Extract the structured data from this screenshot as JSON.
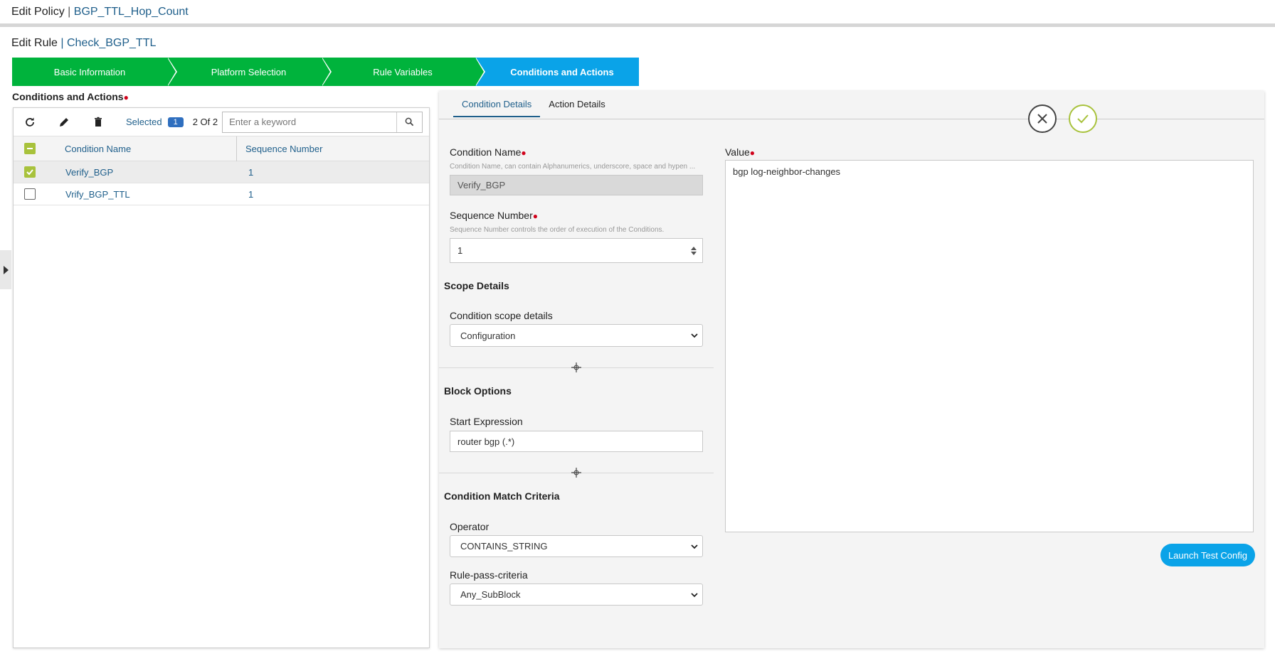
{
  "header": {
    "prefix": "Edit Policy",
    "separator": "|",
    "policy_name": "BGP_TTL_Hop_Count"
  },
  "rule": {
    "prefix": "Edit Rule",
    "separator": "|",
    "rule_name": "Check_BGP_TTL"
  },
  "wizard": {
    "steps": [
      {
        "label": "Basic Information",
        "state": "done"
      },
      {
        "label": "Platform Selection",
        "state": "done"
      },
      {
        "label": "Rule Variables",
        "state": "done"
      },
      {
        "label": "Conditions and Actions",
        "state": "active"
      }
    ],
    "done_color": "#00b33c",
    "active_color": "#0aa3e8"
  },
  "conditions": {
    "section_label": "Conditions and Actions",
    "toolbar": {
      "icons": [
        "refresh-icon",
        "edit-icon",
        "delete-icon"
      ],
      "selected_label": "Selected",
      "selected_count": "1",
      "pagination": "2 Of 2",
      "search_placeholder": "Enter a keyword"
    },
    "columns": {
      "name": "Condition Name",
      "sequence": "Sequence Number"
    },
    "rows": [
      {
        "name": "Verify_BGP",
        "sequence": "1",
        "checked": true
      },
      {
        "name": "Vrify_BGP_TTL",
        "sequence": "1",
        "checked": false
      }
    ]
  },
  "detail": {
    "tabs": [
      {
        "label": "Condition Details",
        "active": true
      },
      {
        "label": "Action Details",
        "active": false
      }
    ],
    "condition_name": {
      "label": "Condition Name",
      "hint": "Condition Name, can contain Alphanumerics, underscore, space and hypen ...",
      "value": "Verify_BGP"
    },
    "sequence_number": {
      "label": "Sequence Number",
      "hint": "Sequence Number controls the order of execution of the Conditions.",
      "value": "1"
    },
    "scope": {
      "heading": "Scope Details",
      "label": "Condition scope details",
      "value": "Configuration"
    },
    "block": {
      "heading": "Block Options",
      "label": "Start Expression",
      "value": "router bgp (.*)"
    },
    "match": {
      "heading": "Condition Match Criteria",
      "operator_label": "Operator",
      "operator_value": "CONTAINS_STRING",
      "criteria_label": "Rule-pass-criteria",
      "criteria_value": "Any_SubBlock"
    },
    "value": {
      "label": "Value",
      "text": "bgp log-neighbor-changes"
    },
    "launch_label": "Launch Test Config"
  }
}
